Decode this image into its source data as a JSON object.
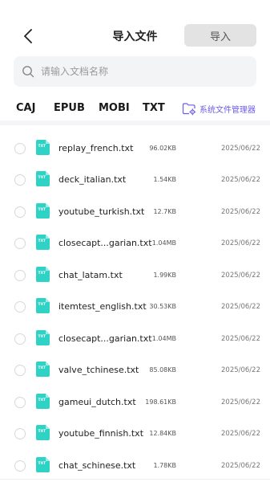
{
  "header": {
    "title": "导入文件",
    "import_label": "导入"
  },
  "search": {
    "placeholder": "请输入文档名称"
  },
  "tabs": [
    "CAJ",
    "EPUB",
    "MOBI",
    "TXT"
  ],
  "system_manager_label": "系统文件管理器",
  "colors": {
    "accent": "#6c5ce7",
    "file_icon": "#2ed3c6",
    "import_button_bg": "#e3e3e3"
  },
  "icons": {
    "back": "chevron-left-icon",
    "search": "search-icon",
    "system_manager": "folder-gear-icon",
    "file": "txt-file-icon"
  },
  "file_icon_label": "TXT",
  "files": [
    {
      "name": "replay_french.txt",
      "size": "96.02KB",
      "date": "2025/06/22"
    },
    {
      "name": "deck_italian.txt",
      "size": "1.54KB",
      "date": "2025/06/22"
    },
    {
      "name": "youtube_turkish.txt",
      "size": "12.7KB",
      "date": "2025/06/22"
    },
    {
      "name": "closecapt...garian.txt",
      "size": "1.04MB",
      "date": "2025/06/22"
    },
    {
      "name": "chat_latam.txt",
      "size": "1.99KB",
      "date": "2025/06/22"
    },
    {
      "name": "itemtest_english.txt",
      "size": "30.53KB",
      "date": "2025/06/22"
    },
    {
      "name": "closecapt...garian.txt",
      "size": "1.04MB",
      "date": "2025/06/22"
    },
    {
      "name": "valve_tchinese.txt",
      "size": "85.08KB",
      "date": "2025/06/22"
    },
    {
      "name": "gameui_dutch.txt",
      "size": "198.61KB",
      "date": "2025/06/22"
    },
    {
      "name": "youtube_finnish.txt",
      "size": "12.84KB",
      "date": "2025/06/22"
    },
    {
      "name": "chat_schinese.txt",
      "size": "1.78KB",
      "date": "2025/06/22"
    }
  ]
}
